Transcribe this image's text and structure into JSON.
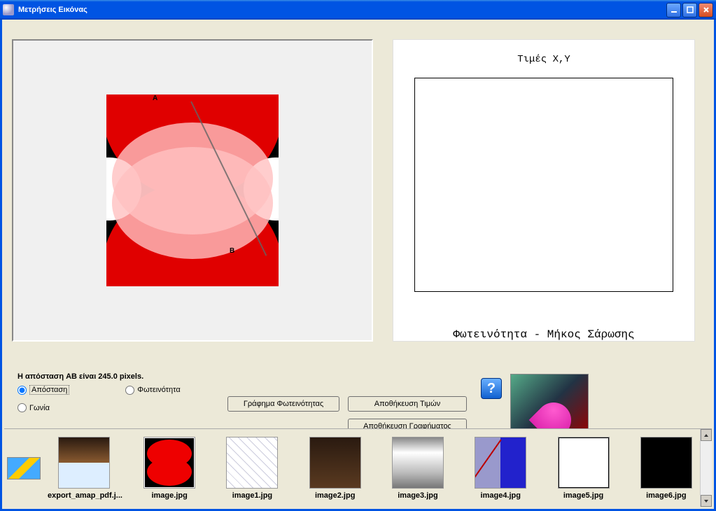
{
  "window": {
    "title": "Μετρήσεις Εικόνας"
  },
  "status_text": "Η απόσταση AB είναι 245.0 pixels.",
  "radios": {
    "distance": "Απόσταση",
    "brightness": "Φωτεινότητα",
    "angle": "Γωνία"
  },
  "buttons": {
    "brightness_graph": "Γράφημα Φωτεινότητας",
    "save_values": "Αποθήκευση Τιμών",
    "save_graph": "Αποθήκευση Γραφήματος"
  },
  "chart": {
    "title": "Τιμές X,Y",
    "xlabel": "Φωτεινότητα - Μήκος Σάρωσης"
  },
  "image_points": {
    "A": "A",
    "B": "B"
  },
  "help_label": "?",
  "thumbnails": [
    {
      "file": "export_amap_pdf.j..."
    },
    {
      "file": "image.jpg"
    },
    {
      "file": "image1.jpg"
    },
    {
      "file": "image2.jpg"
    },
    {
      "file": "image3.jpg"
    },
    {
      "file": "image4.jpg"
    },
    {
      "file": "image5.jpg"
    },
    {
      "file": "image6.jpg"
    }
  ],
  "chart_data": {
    "type": "line",
    "title": "Τιμές X,Y",
    "xlabel": "Φωτεινότητα - Μήκος Σάρωσης",
    "ylabel": "",
    "series": [],
    "categories": []
  }
}
